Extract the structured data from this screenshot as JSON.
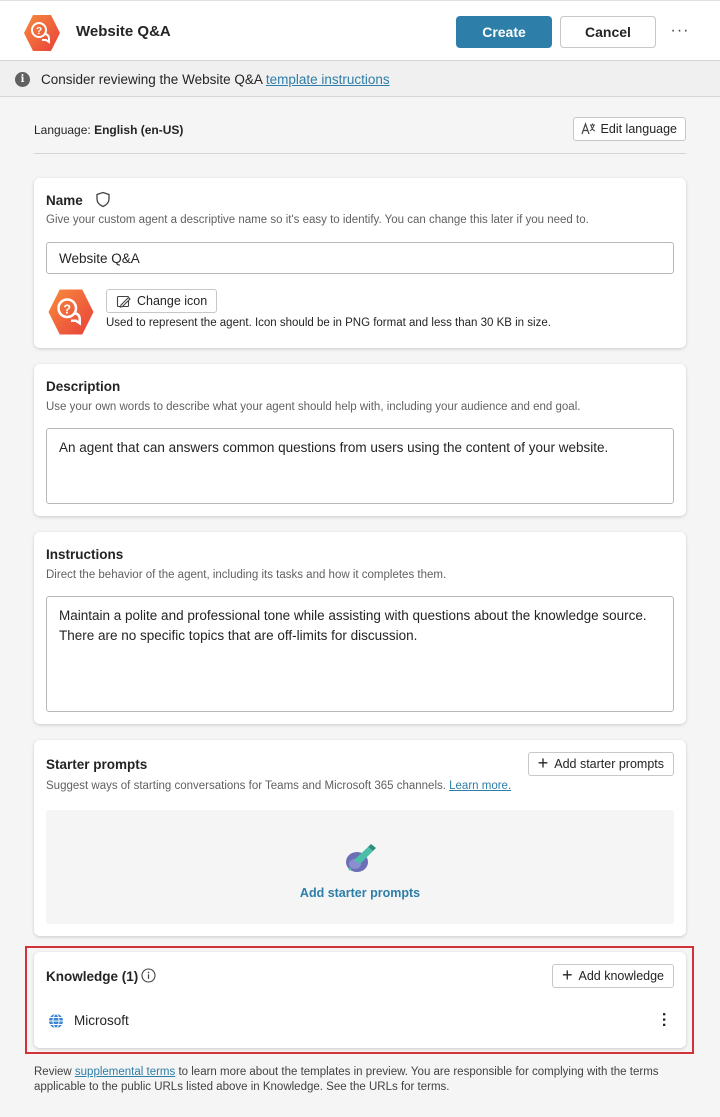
{
  "header": {
    "title": "Website Q&A",
    "create_label": "Create",
    "cancel_label": "Cancel",
    "more_label": "···"
  },
  "banner": {
    "text": "Consider reviewing the Website Q&A ",
    "link": "template instructions"
  },
  "language": {
    "label": "Language: ",
    "value": "English (en-US)",
    "edit_label": "Edit language"
  },
  "name_card": {
    "title": "Name",
    "subtitle": "Give your custom agent a descriptive name so it's easy to identify. You can change this later if you need to.",
    "value": "Website Q&A",
    "change_icon_label": "Change icon",
    "icon_hint": "Used to represent the agent. Icon should be in PNG format and less than 30 KB in size."
  },
  "description_card": {
    "title": "Description",
    "subtitle": "Use your own words to describe what your agent should help with, including your audience and end goal.",
    "value": "An agent that can answers common questions from users using the content of your website."
  },
  "instructions_card": {
    "title": "Instructions",
    "subtitle": "Direct the behavior of the agent, including its tasks and how it completes them.",
    "value": "Maintain a polite and professional tone while assisting with questions about the knowledge source. There are no specific topics that are off-limits for discussion."
  },
  "starter_card": {
    "title": "Starter prompts",
    "subtitle": "Suggest ways of starting conversations for Teams and Microsoft 365 channels. ",
    "learn_more": "Learn more.",
    "add_button": "Add starter prompts",
    "empty_action": "Add starter prompts"
  },
  "knowledge_card": {
    "title": "Knowledge (1)",
    "add_button": "Add knowledge",
    "items": [
      {
        "label": "Microsoft"
      }
    ]
  },
  "footer": {
    "before": "Review ",
    "link": "supplemental terms",
    "after": " to learn more about the templates in preview. You are responsible for complying with the terms applicable to the public URLs listed above in Knowledge. See the URLs for terms."
  },
  "colors": {
    "accent": "#2d7ea8",
    "highlight": "#d13438",
    "logo": "#f2633a"
  }
}
